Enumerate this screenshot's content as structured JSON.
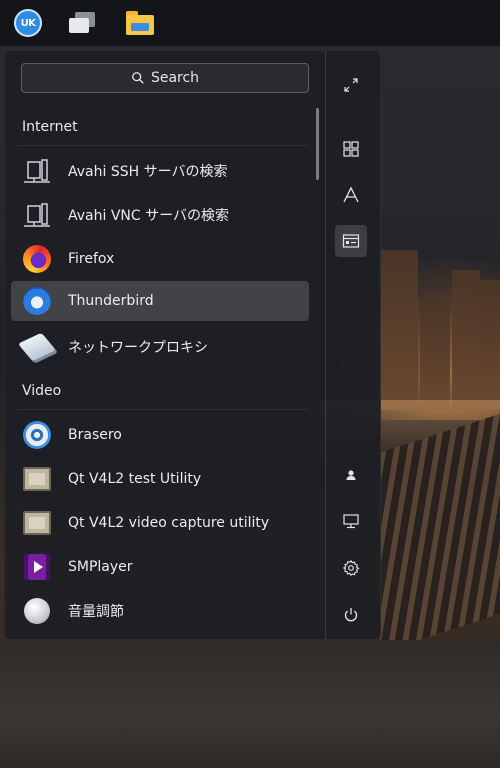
{
  "taskbar": {
    "launcher_text": "UK",
    "items": [
      "launcher",
      "window-switcher",
      "file-manager"
    ]
  },
  "menu": {
    "search_label": "Search",
    "categories": [
      {
        "name": "Internet",
        "apps": [
          {
            "label": "Avahi SSH サーバの検索",
            "icon": "network-server-icon"
          },
          {
            "label": "Avahi VNC サーバの検索",
            "icon": "network-server-icon"
          },
          {
            "label": "Firefox",
            "icon": "firefox-icon"
          },
          {
            "label": "Thunderbird",
            "icon": "thunderbird-icon",
            "selected": true
          },
          {
            "label": "ネットワークプロキシ",
            "icon": "network-proxy-icon"
          }
        ]
      },
      {
        "name": "Video",
        "apps": [
          {
            "label": "Brasero",
            "icon": "brasero-icon"
          },
          {
            "label": "Qt V4L2 test Utility",
            "icon": "video-film-icon"
          },
          {
            "label": "Qt V4L2 video capture utility",
            "icon": "video-film-icon"
          },
          {
            "label": "SMPlayer",
            "icon": "smplayer-icon"
          },
          {
            "label": "音量調節",
            "icon": "volume-control-icon"
          }
        ]
      }
    ],
    "side_buttons_top": [
      "expand",
      "all-apps-grid",
      "alphabetical",
      "category-view"
    ],
    "side_buttons_bottom": [
      "user",
      "computer",
      "settings",
      "power"
    ],
    "active_view": "category-view"
  },
  "colors": {
    "taskbar_bg": "#141518",
    "menu_bg": "#1e1f24",
    "selected_bg": "#4a4b50",
    "text": "#ececee"
  }
}
